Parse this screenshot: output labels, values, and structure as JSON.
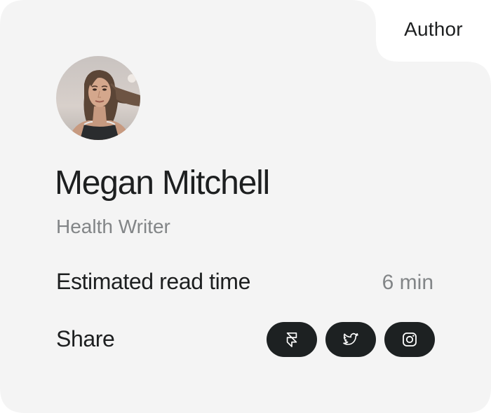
{
  "card": {
    "tab_label": "Author",
    "background": "#f4f4f4"
  },
  "author": {
    "name": "Megan Mitchell",
    "role": "Health Writer"
  },
  "read_time": {
    "label": "Estimated read time",
    "value": "6 min"
  },
  "share": {
    "label": "Share",
    "buttons": [
      {
        "icon": "framer-icon"
      },
      {
        "icon": "twitter-icon"
      },
      {
        "icon": "instagram-icon"
      }
    ]
  },
  "colors": {
    "text_primary": "#1d1f20",
    "text_secondary": "#828587",
    "button_bg": "#1d2122",
    "button_icon": "#ffffff"
  }
}
